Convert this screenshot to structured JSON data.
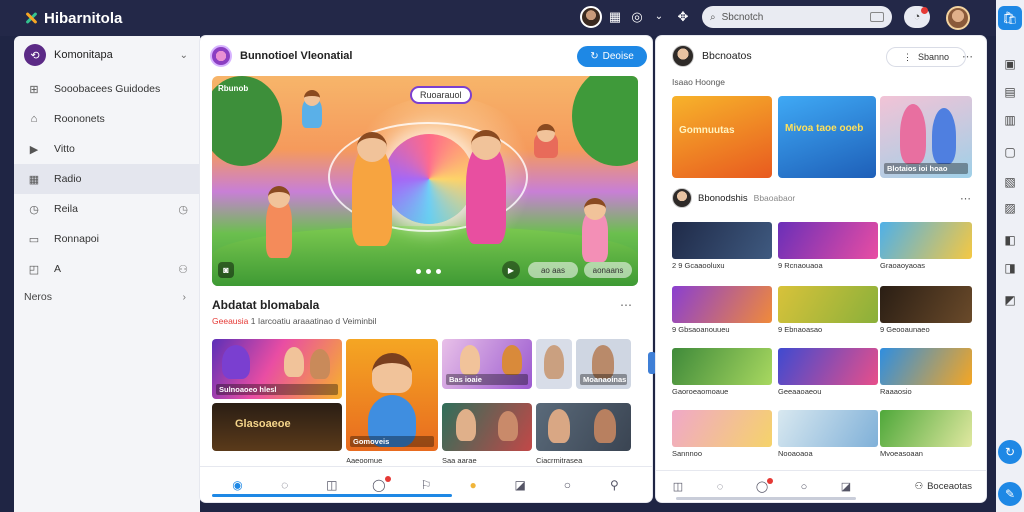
{
  "app": {
    "title": "Hibarnitola"
  },
  "top": {
    "search_placeholder": "Sbcnotch",
    "icons": [
      "avatar-icon",
      "grid-icon",
      "broadcast-icon",
      "chevron-down-icon",
      "puzzle-icon",
      "bell-icon",
      "user-avatar"
    ]
  },
  "sidebar": {
    "header": "Komonitapa",
    "items": [
      {
        "icon": "home-icon",
        "label": "Sooobacees Guidodes"
      },
      {
        "icon": "house-icon",
        "label": "Roononets"
      },
      {
        "icon": "video-icon",
        "label": "Vitto"
      },
      {
        "icon": "folder-icon",
        "label": "Radio",
        "active": true
      },
      {
        "icon": "clock-icon",
        "label": "Reila",
        "trail": "clock"
      },
      {
        "icon": "news-icon",
        "label": "Ronnapoi"
      },
      {
        "icon": "calendar-icon",
        "label": "A",
        "trail": "people"
      }
    ],
    "more": "Neros"
  },
  "center": {
    "title": "Bunnotioel Vleonatial",
    "follow_label": "Deoise",
    "hero": {
      "tag": "Rbunob",
      "label": "Ruoarauol",
      "btn1": "ao aas",
      "btn2": "aonaans"
    },
    "section": {
      "title": "Abdatat blomabala",
      "sub_highlight": "Geeausia",
      "sub_rest": "1 Iarcoatiu araaatinao d Veiminbil"
    },
    "thumbs": [
      "Sulnoaoeo hlesl",
      "Gomoveis",
      "Bas ioaie",
      "Moanaoinas",
      "Glasoaeoe",
      "Aaeoomue",
      "Saa aarae",
      "Ciacrmitrasea"
    ]
  },
  "right": {
    "title": "Bbcnoatos",
    "sub": "Isaao Hoonge",
    "pill": "Sbanno",
    "row_title": "Bbonodshis",
    "row_sub": "Bbaoabaor",
    "top_cards": [
      "Gomnuutas",
      "Mivoa taoe ooeb",
      "Blotaios ioi hoao"
    ],
    "cards": [
      "2 9 Gcaaooluxu",
      "9 Rcnaouaoa",
      "Graoaoyaoas",
      "9 Gbsaoanouueu",
      "9 Ebnaoasao",
      "9 Geooaunaeo",
      "Gaoroeaomoaue",
      "Geeaaoaeou",
      "Raaaosio",
      "Sannnoo",
      "Nooaoaoa",
      "Mvoeasoaan"
    ],
    "tab_label": "Boceaotas"
  },
  "colors": {
    "accent": "#1e88e5",
    "topbar": "#232848",
    "badge": "#e53935",
    "brand_purple": "#5b2a86"
  }
}
